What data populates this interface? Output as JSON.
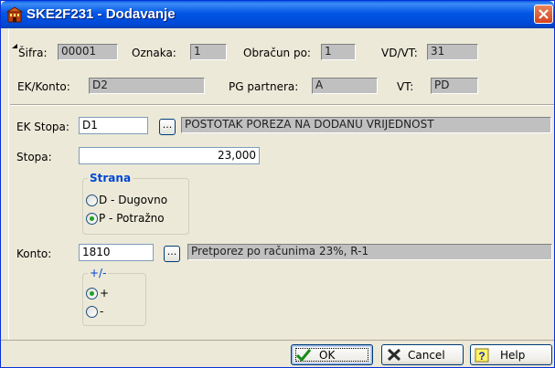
{
  "window": {
    "title": "SKE2F231 - Dodavanje",
    "accent": "#0055e5"
  },
  "header_fields": {
    "sifra_label": "Šifra:",
    "sifra_value": "00001",
    "oznaka_label": "Oznaka:",
    "oznaka_value": "1",
    "obracun_label": "Obračun po:",
    "obracun_value": "1",
    "vdvt_label": "VD/VT:",
    "vdvt_value": "31",
    "ekkonto_label": "EK/Konto:",
    "ekkonto_value": "D2",
    "pg_label": "PG partnera:",
    "pg_value": "A",
    "vt_label": "VT:",
    "vt_value": "PD"
  },
  "form": {
    "ekstopa_label": "EK Stopa:",
    "ekstopa_value": "D1",
    "ekstopa_button": "...",
    "ekstopa_desc": "POSTOTAK POREZA NA DODANU VRIJEDNOST",
    "stopa_label": "Stopa:",
    "stopa_value": "23,000",
    "strana": {
      "title": "Strana",
      "options": [
        "D - Dugovno",
        "P - Potražno"
      ],
      "selected": "P - Potražno"
    },
    "konto_label": "Konto:",
    "konto_value": "1810",
    "konto_button": "...",
    "konto_desc": "Pretporez po računima 23%, R-1",
    "sign": {
      "title": "+/-",
      "options": [
        "+",
        "-"
      ],
      "selected": "+"
    }
  },
  "buttons": {
    "ok": "OK",
    "cancel": "Cancel",
    "help": "Help"
  },
  "icons": {
    "app": "building-icon",
    "close": "close-icon",
    "ok": "checkmark-icon",
    "cancel": "x-icon",
    "help": "question-icon"
  }
}
